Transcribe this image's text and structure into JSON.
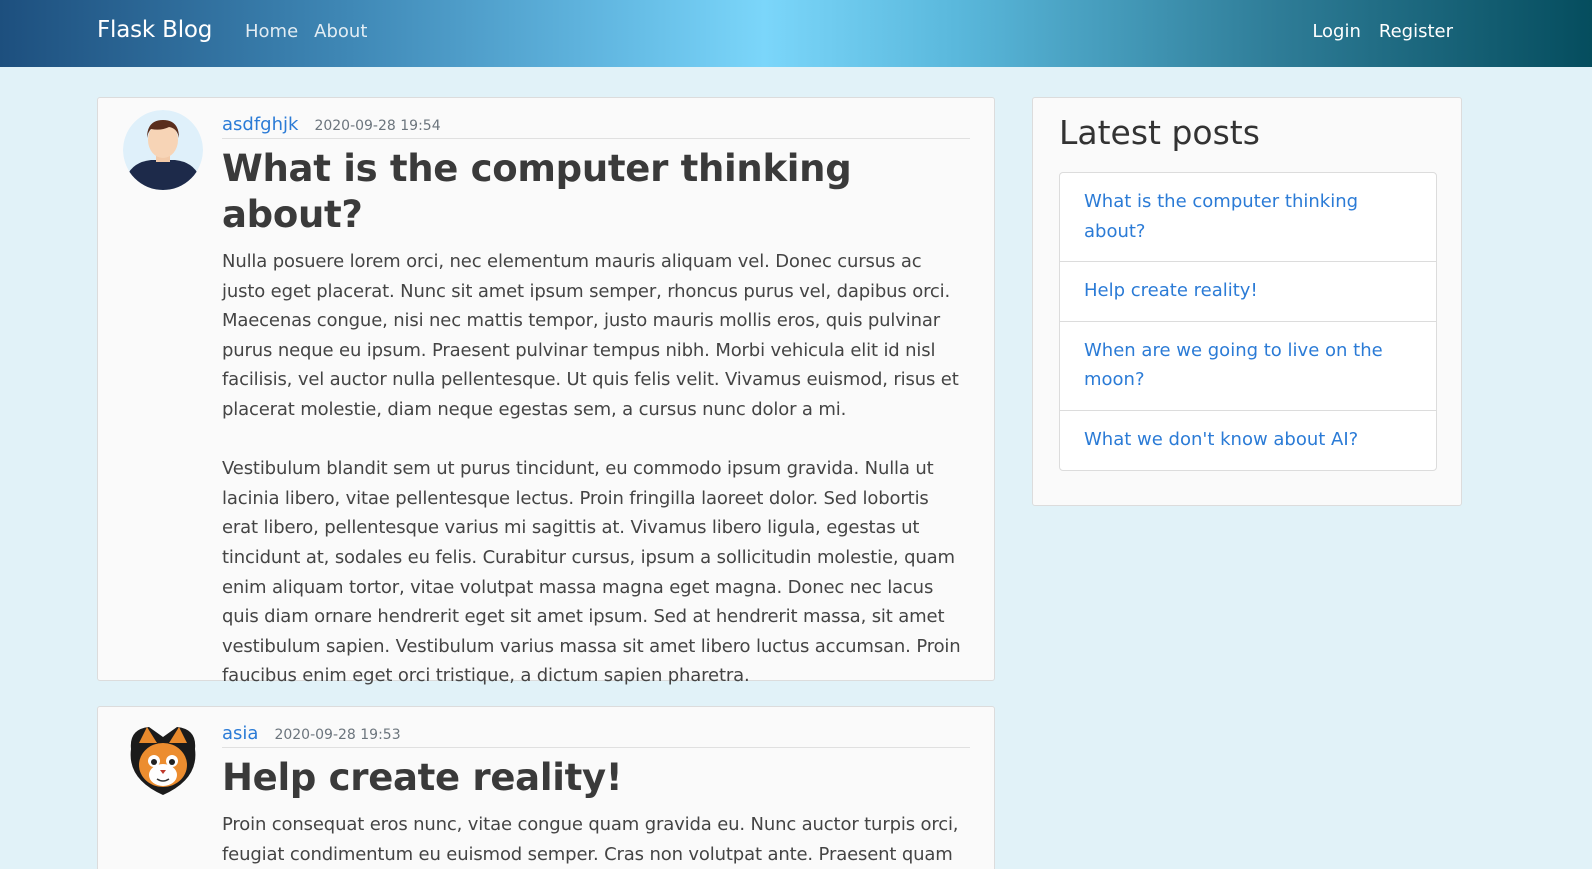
{
  "navbar": {
    "brand": "Flask Blog",
    "left_links": [
      "Home",
      "About"
    ],
    "right_links": [
      "Login",
      "Register"
    ]
  },
  "posts": [
    {
      "author": "asdfghjk",
      "date": "2020-09-28 19:54",
      "title": "What is the computer thinking about?",
      "content": "Nulla posuere lorem orci, nec elementum mauris aliquam vel. Donec cursus ac justo eget placerat. Nunc sit amet ipsum semper, rhoncus purus vel, dapibus orci. Maecenas congue, nisi nec mattis tempor, justo mauris mollis eros, quis pulvinar purus neque eu ipsum. Praesent pulvinar tempus nibh. Morbi vehicula elit id nisl facilisis, vel auctor nulla pellentesque. Ut quis felis velit. Vivamus euismod, risus et placerat molestie, diam neque egestas sem, a cursus nunc dolor a mi.\n\nVestibulum blandit sem ut purus tincidunt, eu commodo ipsum gravida. Nulla ut lacinia libero, vitae pellentesque lectus. Proin fringilla laoreet dolor. Sed lobortis erat libero, pellentesque varius mi sagittis at. Vivamus libero ligula, egestas ut tincidunt at, sodales eu felis. Curabitur cursus, ipsum a sollicitudin molestie, quam enim aliquam tortor, vitae volutpat massa magna eget magna. Donec nec lacus quis diam ornare hendrerit eget sit amet ipsum. Sed at hendrerit massa, sit amet vestibulum sapien. Vestibulum varius massa sit amet libero luctus accumsan. Proin faucibus enim eget orci tristique, a dictum sapien pharetra."
    },
    {
      "author": "asia",
      "date": "2020-09-28 19:53",
      "title": "Help create reality!",
      "content": "Proin consequat eros nunc, vitae congue quam gravida eu. Nunc auctor turpis orci, feugiat condimentum eu euismod semper. Cras non volutpat ante. Praesent quam"
    }
  ],
  "sidebar": {
    "title": "Latest posts",
    "items": [
      "What is the computer thinking about?",
      "Help create reality!",
      "When are we going to live on the moon?",
      "What we don't know about AI?"
    ]
  }
}
